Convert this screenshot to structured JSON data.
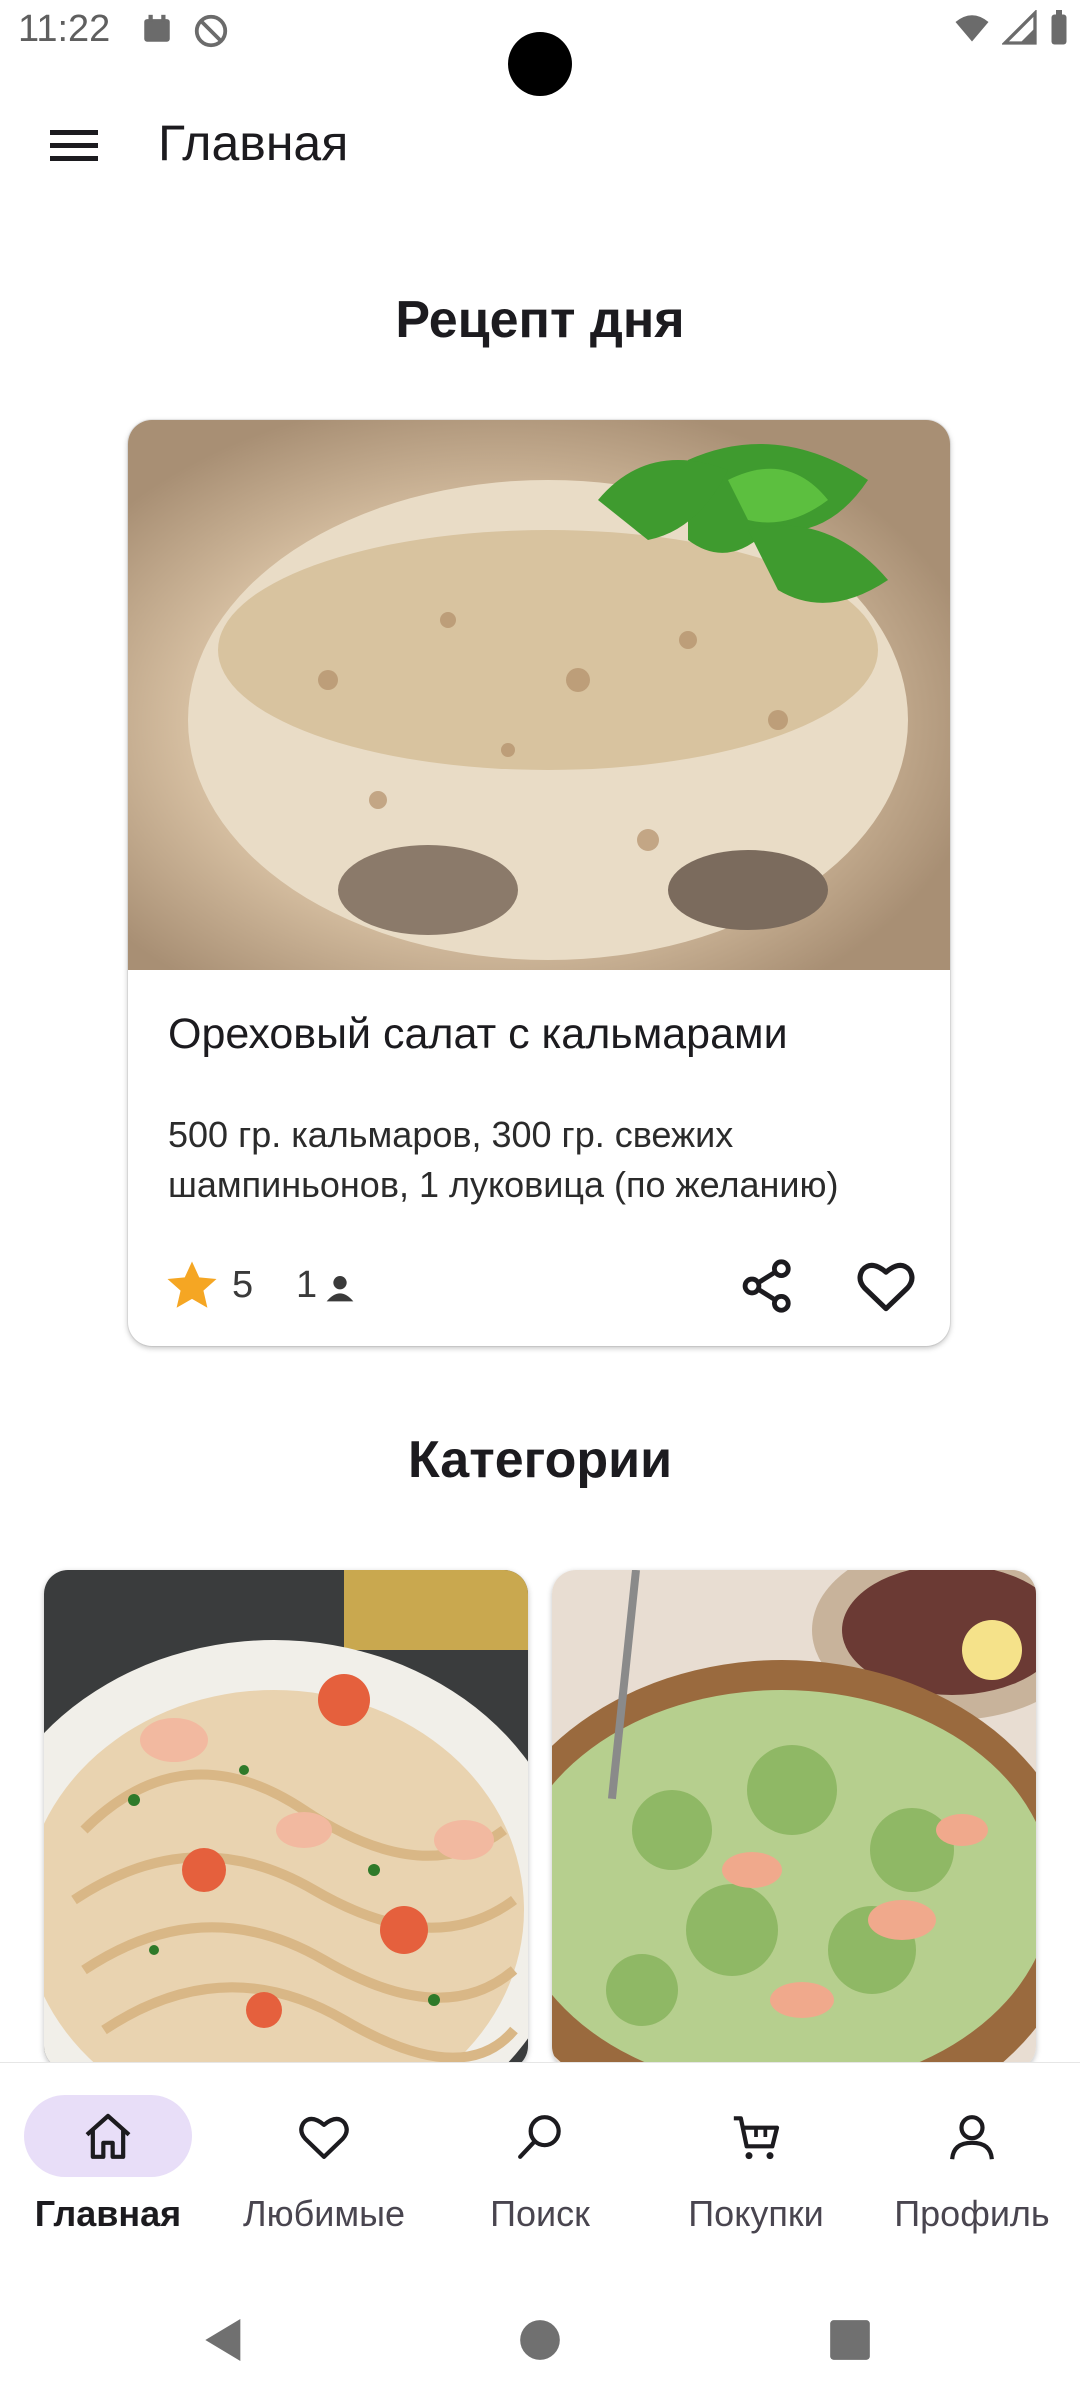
{
  "status_bar": {
    "time": "11:22"
  },
  "app_bar": {
    "title": "Главная"
  },
  "recipe_of_day": {
    "heading": "Рецепт  дня",
    "name": "Ореховый салат с кальмарами",
    "description": "500 гр. кальмаров, 300 гр. свежих шампиньонов, 1 луковица (по желанию)",
    "rating": "5",
    "reviews": "1"
  },
  "categories": {
    "heading": "Категории"
  },
  "bottom_nav": {
    "items": [
      {
        "label": "Главная",
        "icon": "home-icon",
        "active": true
      },
      {
        "label": "Любимые",
        "icon": "heart-icon"
      },
      {
        "label": "Поиск",
        "icon": "search-icon"
      },
      {
        "label": "Покупки",
        "icon": "cart-icon"
      },
      {
        "label": "Профиль",
        "icon": "person-icon"
      }
    ]
  },
  "colors": {
    "accent": "#e8def8",
    "star": "#f5a623",
    "text": "#1c1b1f"
  }
}
